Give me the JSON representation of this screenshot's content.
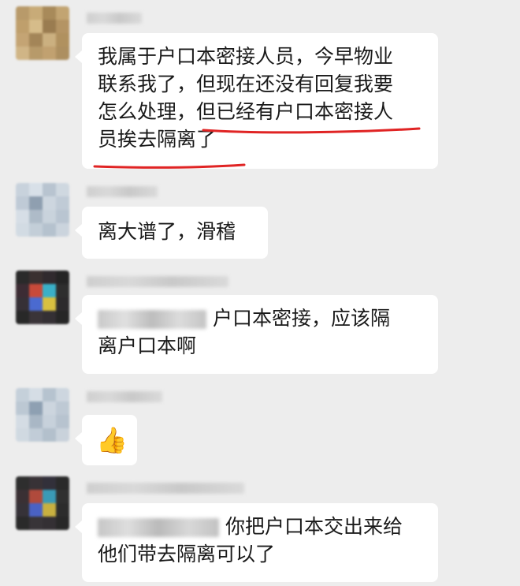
{
  "messages": [
    {
      "id": "msg1",
      "lines": [
        "我属于户口本密接人员，今早物业",
        "联系我了，但现在还没有回复我要",
        "怎么处理，",
        "但已经有户口本密接人",
        "员挨去隔离了"
      ],
      "underlined": "但已经有户口本密接人员挨去隔离了"
    },
    {
      "id": "msg2",
      "lines": [
        "离大谱了，滑稽"
      ]
    },
    {
      "id": "msg3",
      "lines": [
        "户口本密接，应该隔",
        "离户口本啊"
      ],
      "redacted_mention": true
    },
    {
      "id": "msg4",
      "emoji": "👍",
      "emoji_name": "thumbs-up"
    },
    {
      "id": "msg5",
      "lines": [
        "你把户口本交出来给",
        "他们带去隔离可以了"
      ],
      "redacted_mention": true
    }
  ],
  "colors": {
    "background": "#ededed",
    "bubble": "#ffffff",
    "underline": "#e02424",
    "text": "#1a1a1a"
  }
}
